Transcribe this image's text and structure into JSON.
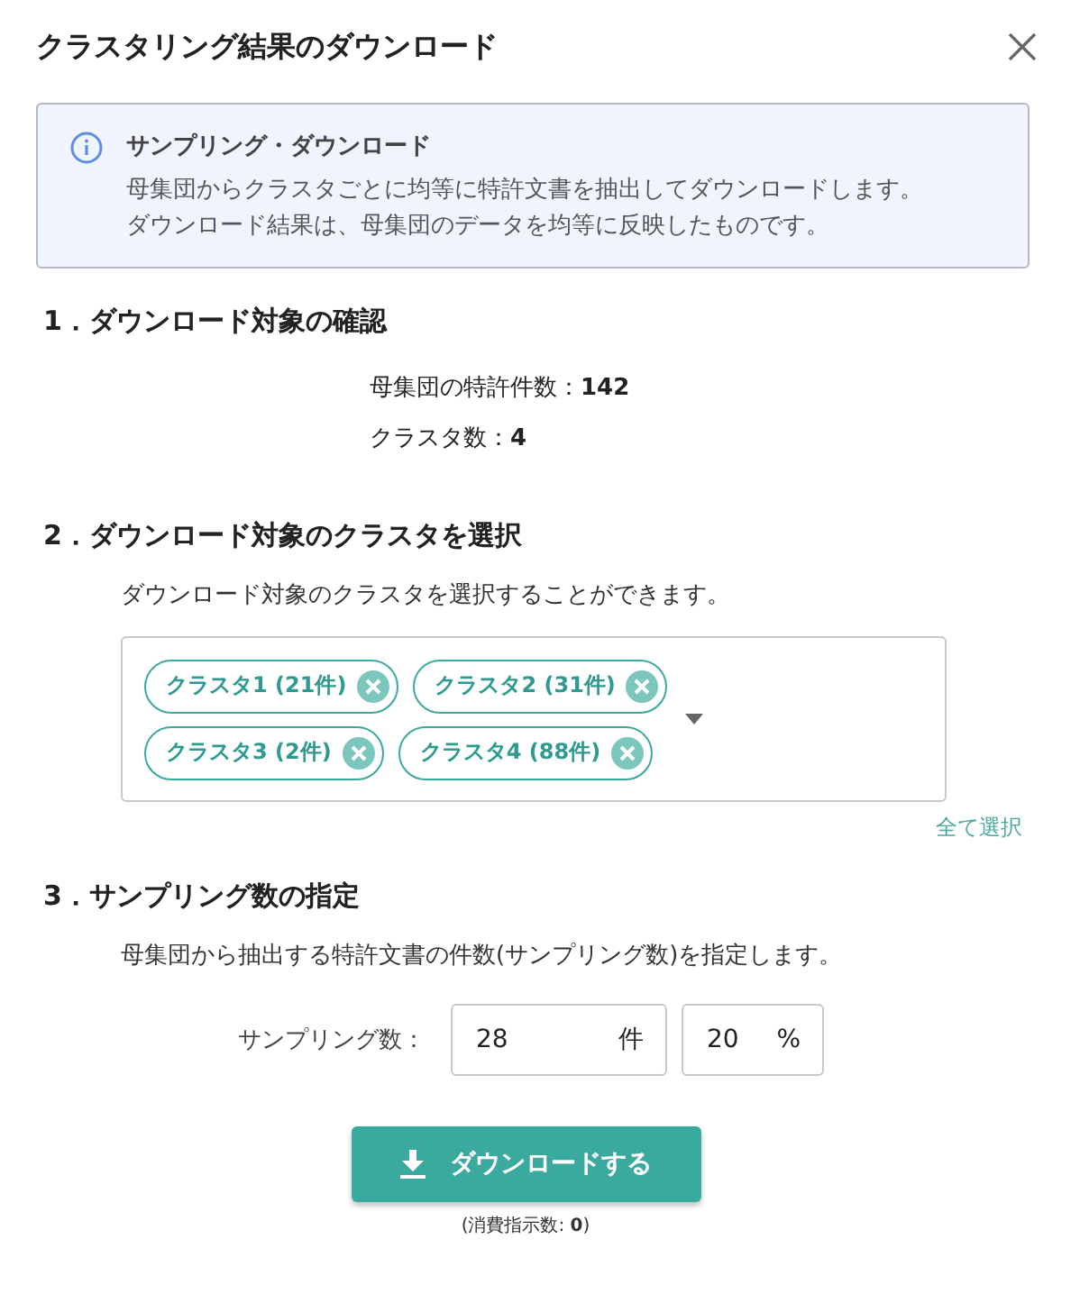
{
  "dialog": {
    "title": "クラスタリング結果のダウンロード"
  },
  "info": {
    "title": "サンプリング・ダウンロード",
    "lines": [
      "母集団からクラスタごとに均等に特許文書を抽出してダウンロードします。",
      "ダウンロード結果は、母集団のデータを均等に反映したものです。"
    ]
  },
  "section1": {
    "heading": "1．ダウンロード対象の確認",
    "stats": [
      "母集団の特許件数：**142**",
      "クラスタ数：**4**"
    ]
  },
  "section2": {
    "heading": "2．ダウンロード対象のクラスタを選択",
    "description": "ダウンロード対象のクラスタを選択することができます。",
    "chips": [
      {
        "label": "クラスタ1 (21件)"
      },
      {
        "label": "クラスタ2 (31件)"
      },
      {
        "label": "クラスタ3 (2件)"
      },
      {
        "label": "クラスタ4 (88件)"
      }
    ],
    "select_all": "全て選択"
  },
  "section3": {
    "heading": "3．サンプリング数の指定",
    "description": "母集団から抽出する特許文書の件数(サンプリング数)を指定します。",
    "label": "サンプリング数：",
    "count": {
      "value": "28",
      "unit": "件"
    },
    "percent": {
      "value": "20",
      "unit": "%"
    }
  },
  "download_button": "ダウンロードする",
  "consumption": "(消費指示数: **0**)"
}
